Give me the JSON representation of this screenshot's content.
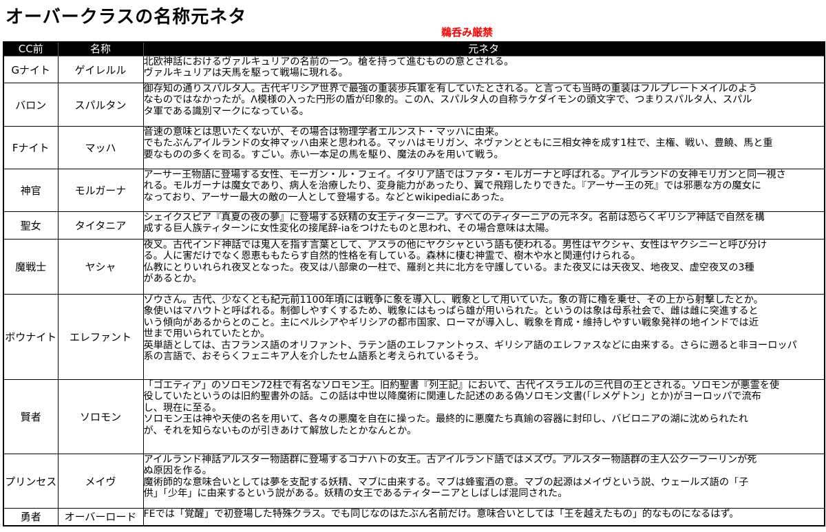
{
  "title": "オーバークラスの名称元ネタ",
  "warning": "鵜呑み厳禁",
  "table": {
    "headers": {
      "cc": "CC前",
      "name": "名称",
      "source": "元ネタ"
    },
    "rows": [
      {
        "cc": "Gナイト",
        "name": "ゲイレルル",
        "lines": [
          "北欧神話におけるヴァルキュリアの名前の一つ。槍を持って進むものの意とされる。",
          "ヴァルキュリアは天馬を駆って戦場に現れる。"
        ]
      },
      {
        "cc": "バロン",
        "name": "スパルタン",
        "lines": [
          "御存知の通りスパルタ人。古代ギリシア世界で最強の重装歩兵軍を有していたとされる。と言っても当時の重装はフルプレートメイルのよう",
          "なものではなかったが。Λ模様の入った円形の盾が印象的。このΛ、スパルタ人の自称ラケダイモンの頭文字で、つまりスパルタ人、スパル",
          "タ軍である識別マークになっている。"
        ]
      },
      {
        "cc": "Fナイト",
        "name": "マッハ",
        "lines": [
          "音速の意味とは思いたくないが、その場合は物理学者エルンスト・マッハに由来。",
          "でもたぶんアイルランドの女神マッハ由来と思われる。マッハはモリガン、ネヴァンとともに三相女神を成す1柱で、主権、戦い、豊饒、馬と重",
          "要なものの多くを司る。すごい。赤い一本足の馬を駆り、魔法のみを用いて戦う。"
        ]
      },
      {
        "cc": "神官",
        "name": "モルガーナ",
        "lines": [
          "アーサー王物語に登場する女性、モーガン・ル・フェイ。イタリア語ではファタ・モルガーナと呼ばれる。アイルランドの女神モリガンと同一視さ",
          "れる。モルガーナは魔女であり、病人を治療したり、変身能力があったり、翼で飛翔したりできた。『アーサー王の死』では邪悪な方の魔女に",
          "なっており、アーサー最大の敵の一人として登場する。などとwikipediaにあった。"
        ]
      },
      {
        "cc": "聖女",
        "name": "タイタニア",
        "lines": [
          "シェイクスピア『真夏の夜の夢』に登場する妖精の女王ティターニア。すべてのティターニアの元ネタ。名前は恐らくギリシア神話で自然を構",
          "成する巨人族ティターンに女性変化の接尾辞-iaをつけたものと思われ、その場合意味は太陽。"
        ]
      },
      {
        "cc": "魔戦士",
        "name": "ヤシャ",
        "lines": [
          "夜叉。古代インド神話では鬼人を指す言葉として、アスラの他にヤクシャという語も使われる。男性はヤクシャ、女性はヤクシニーと呼び分け",
          "る。人に害だけでなく恩恵ももたらす自然的性格を有している。森林に棲む神霊で、樹木や水と関連付けられる。",
          "仏教にとりいれられ夜叉となった。夜叉は八部衆の一柱で、羅刹と共に北方を守護している。また夜叉には天夜叉、地夜叉、虚空夜叉の3種",
          "があるとか。"
        ]
      },
      {
        "cc": "ボウナイト",
        "name": "エレファント",
        "lines": [
          "ゾウさん。古代、少なくとも紀元前1100年頃には戦争に象を導入し、戦象として用いていた。象の背に櫓を乗せ、その上から射撃したとか。",
          "象使いはマハウトと呼ばれる。制御しやすくするため、戦象にはもっぱら雄が用いられた。というのは象は母系社会で、雌は雌に突進すると",
          "いう傾向があるからとのこと。主にペルシアやギリシアの都市国家、ローマが導入し、戦象を育成・維持しやすい戦象発祥の地インドでは近",
          "世まで用いられていたとか。",
          "英単語としては、古フランス語のオリファント、ラテン語のエレファントゥス、ギリシア語のエレファスなどに由来する。さらに遡ると非ヨーロッパ",
          "系の言語で、おそらくフェニキア人を介したセム語系と考えられているそう。"
        ]
      },
      {
        "cc": "賢者",
        "name": "ソロモン",
        "lines": [
          "「ゴエティア」のソロモン72柱で有名なソロモン王。旧約聖書『列王記』において、古代イスラエルの三代目の王とされる。ソロモンが悪霊を使",
          "役していたというのは旧約聖書外の話。この話は中世以降魔術に関連した記述のある偽ソロモン文書(「レメゲトン」とか)がヨーロッパで流布",
          "し、現在に至る。",
          "ソロモン王は神や天使の名を用いて、各々の悪魔を自在に操った。最終的に悪魔たち真鍮の容器に封印し、バビロニアの湖に沈められたれ",
          "が、それを知らないものが引きあけて解放したとかなんとか。"
        ]
      },
      {
        "cc": "プリンセス",
        "name": "メイヴ",
        "lines": [
          "アイルランド神話アルスター物語群に登場するコナハトの女王。古アイルランド語ではメズヴ。アルスター物語群の主人公クーフーリンが死",
          "ぬ原因を作る。",
          "魔術師的な意味合いとしては夢を支配する妖精、マブに由来する。マブは蜂蜜酒の意。マブの起源はメイヴという説、ウェールズ語の「子",
          "供」「少年」に由来するという説がある。妖精の女王であるティターニアとしばしば混同された。"
        ]
      },
      {
        "cc": "勇者",
        "name": "オーバーロード",
        "lines": [
          "FEでは「覚醒」で初登場した特殊クラス。でも同じなのはたぶん名前だけ。意味合いとしては「王を越えたもの」的なものになるはず。"
        ]
      }
    ]
  }
}
